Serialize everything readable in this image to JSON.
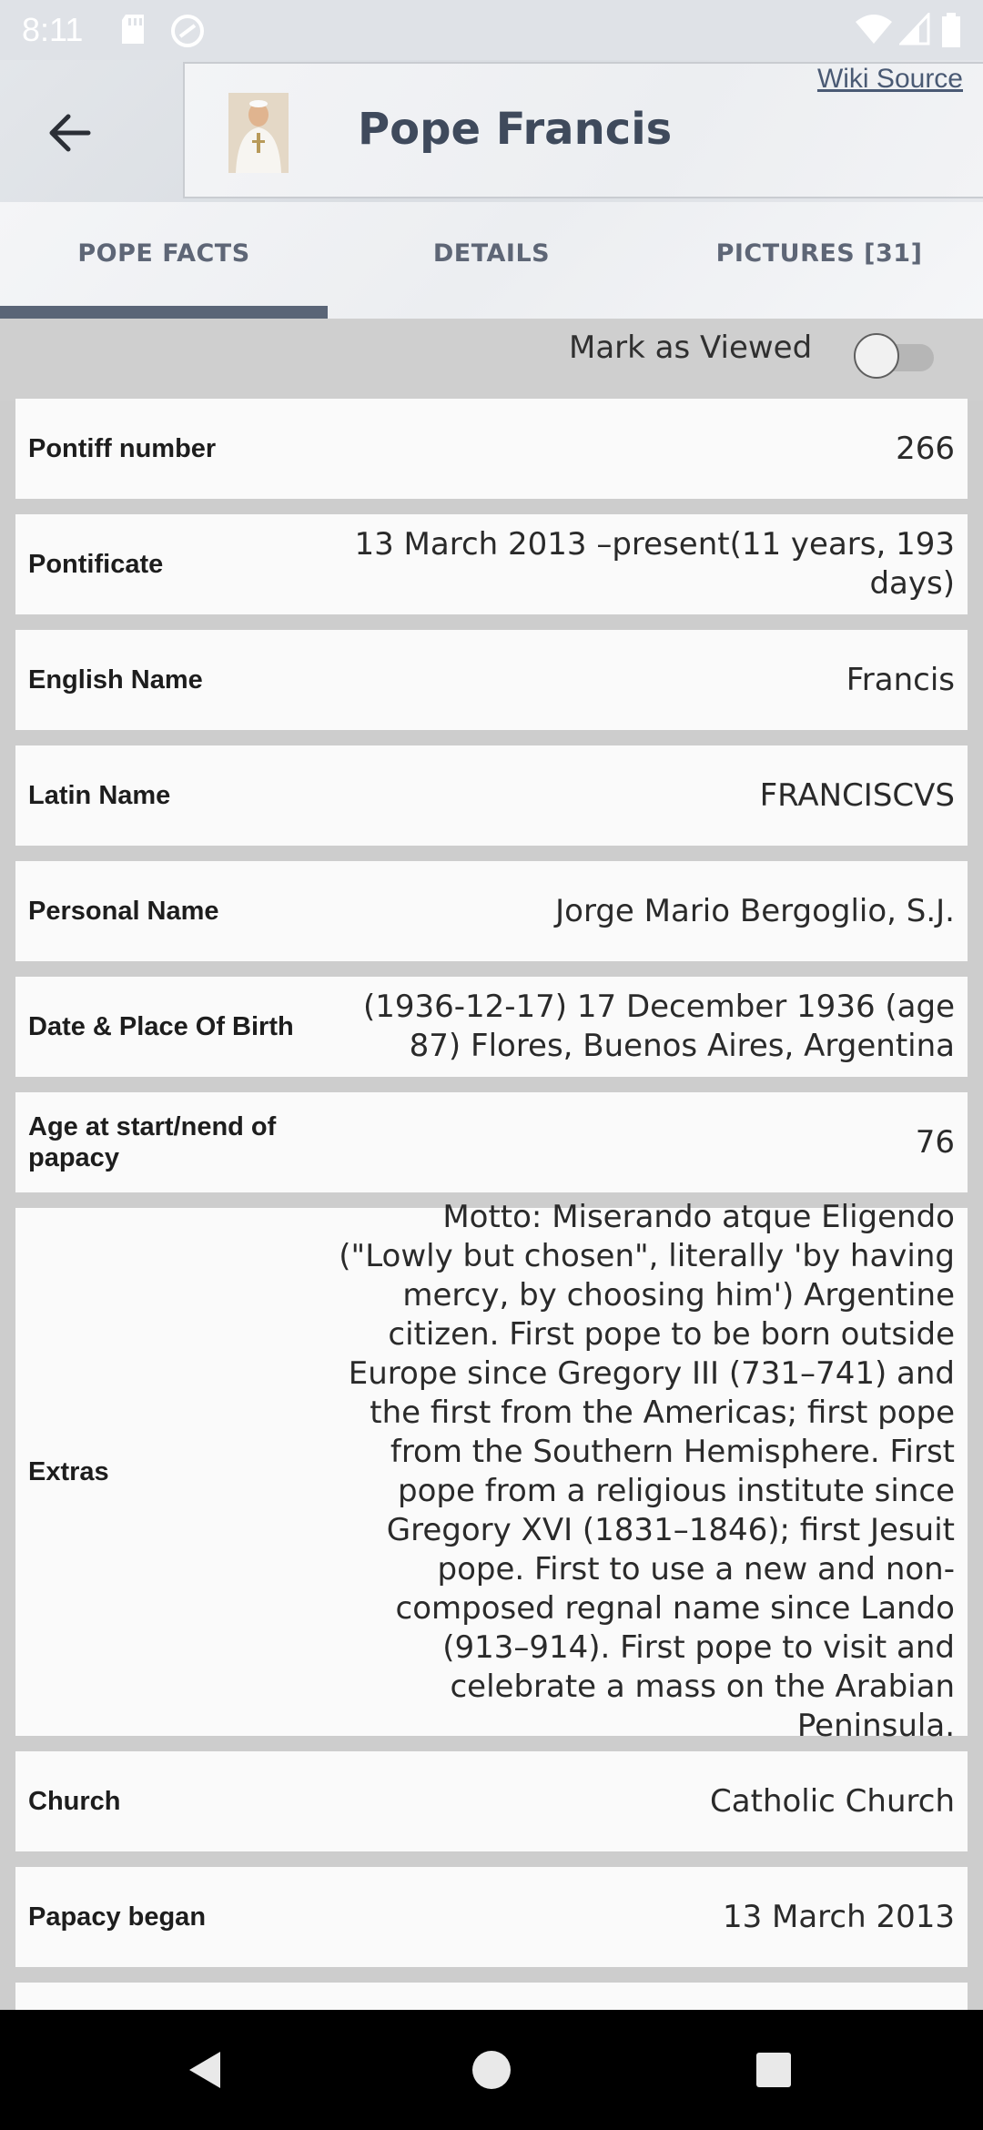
{
  "status_bar": {
    "time": "8:11",
    "icons": [
      "sd-card-icon",
      "sync-icon",
      "wifi-icon",
      "signal-icon",
      "battery-icon"
    ]
  },
  "header": {
    "back_icon": "arrow-left-icon",
    "title": "Pope Francis",
    "wiki_link": "Wiki Source"
  },
  "tabs": [
    {
      "label": "POPE FACTS",
      "active": true
    },
    {
      "label": "DETAILS",
      "active": false
    },
    {
      "label": "PICTURES [31]",
      "active": false
    }
  ],
  "mark_viewed": {
    "label": "Mark as Viewed",
    "on": false
  },
  "facts": [
    {
      "label": "Pontiff number",
      "value": "266"
    },
    {
      "label": "Pontificate",
      "value": "13 March 2013 –present(11 years, 193 days)"
    },
    {
      "label": "English Name",
      "value": "Francis"
    },
    {
      "label": "Latin Name",
      "value": "FRANCISCVS"
    },
    {
      "label": "Personal Name",
      "value": "Jorge Mario Bergoglio, S.J."
    },
    {
      "label": "Date & Place Of Birth",
      "value": "(1936-12-17) 17 December 1936 (age 87) Flores, Buenos Aires, Argentina"
    },
    {
      "label": "Age at start/nend of papacy",
      "value": "76"
    },
    {
      "label": "Extras",
      "value": "Motto: Miserando atque Eligendo (\"Lowly but chosen\", literally 'by having mercy, by choosing him') Argentine citizen. First pope to be born outside Europe since Gregory III (731–741) and the first from the Americas; first pope from the Southern Hemisphere. First pope from a religious institute since Gregory XVI (1831–1846); first Jesuit pope. First to use a new and non-composed regnal name since Lando (913–914). First pope to visit and celebrate a mass on the Arabian Peninsula."
    },
    {
      "label": "Church",
      "value": "Catholic Church"
    },
    {
      "label": "Papacy began",
      "value": "13 March 2013"
    },
    {
      "label": "",
      "value": ""
    }
  ],
  "nav": [
    "back-triangle-icon",
    "home-circle-icon",
    "recents-square-icon"
  ]
}
